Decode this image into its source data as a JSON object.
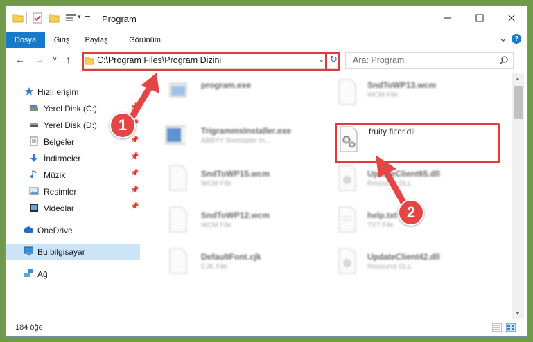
{
  "window": {
    "title": "Program",
    "minimize_icon": "minimize-icon",
    "maximize_icon": "maximize-icon",
    "close_icon": "close-icon"
  },
  "ribbon": {
    "tabs": [
      {
        "label": "Dosya",
        "active": true
      },
      {
        "label": "Giriş",
        "active": false
      },
      {
        "label": "Paylaş",
        "active": false
      },
      {
        "label": "Görünüm",
        "active": false
      }
    ],
    "expand_glyph": "⌄",
    "help_glyph": "?"
  },
  "navigation": {
    "back": "←",
    "forward": "→",
    "recent": "˅",
    "up": "↑",
    "address_path": "C:\\Program Files\\Program Dizini",
    "search_placeholder": "Ara: Program"
  },
  "sidebar": {
    "items": [
      {
        "label": "Hızlı erişim",
        "icon": "star-icon"
      },
      {
        "label": "Yerel Disk (C:)",
        "icon": "drive-icon",
        "pinned": true
      },
      {
        "label": "Yerel Disk (D:)",
        "icon": "drive-icon",
        "pinned": true
      },
      {
        "label": "Belgeler",
        "icon": "documents-icon",
        "pinned": true
      },
      {
        "label": "İndirmeler",
        "icon": "download-icon",
        "pinned": true
      },
      {
        "label": "Müzik",
        "icon": "music-icon",
        "pinned": true
      },
      {
        "label": "Resimler",
        "icon": "pictures-icon",
        "pinned": true
      },
      {
        "label": "Videolar",
        "icon": "video-icon",
        "pinned": true
      },
      {
        "label": "OneDrive",
        "icon": "cloud-icon"
      },
      {
        "label": "Bu bilgisayar",
        "icon": "computer-icon",
        "selected": true
      },
      {
        "label": "Ağ",
        "icon": "network-icon"
      }
    ]
  },
  "files": [
    {
      "name": "program.exe",
      "type": ""
    },
    {
      "name": "SndToWP13.wcm",
      "type": "WCM File"
    },
    {
      "name": "TrigrammsInstaller.exe",
      "type": "ABBYY finereader tri..."
    },
    {
      "name": "fruity filter.dll",
      "type": "",
      "highlighted": true
    },
    {
      "name": "SndToWP15.wcm",
      "type": "WCM File"
    },
    {
      "name": "UpdateClient65.dll",
      "type": "Resource DLL"
    },
    {
      "name": "SndToWP12.wcm",
      "type": "WCM File"
    },
    {
      "name": "help.txt",
      "type": "TXT File"
    },
    {
      "name": "DefaultFont.cjk",
      "type": "CJK File"
    },
    {
      "name": "UpdateClient42.dll",
      "type": "Resource DLL"
    }
  ],
  "status": {
    "item_count": "184 öğe"
  },
  "callouts": [
    "1",
    "2"
  ],
  "colors": {
    "accent": "#1979ca",
    "highlight": "#e03a3a",
    "selection": "#cce4f7"
  }
}
